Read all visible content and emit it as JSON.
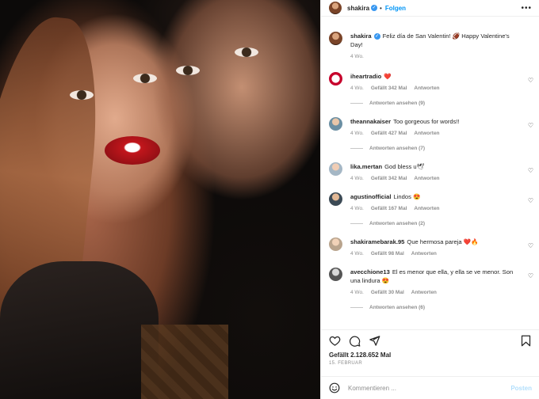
{
  "header": {
    "username": "shakira",
    "follow_label": "Folgen"
  },
  "caption": {
    "username": "shakira",
    "text": "Feliz día de San Valentin! 🏈 Happy Valentine's Day!",
    "time": "4 Wo."
  },
  "comments": [
    {
      "username": "iheartradio",
      "text": "❤️",
      "time": "4 Wo.",
      "likes": "Gefällt 342 Mal",
      "reply": "Antworten",
      "replies": "Antworten ansehen (9)"
    },
    {
      "username": "theannakaiser",
      "text": "Too gorgeous for words!!",
      "time": "4 Wo.",
      "likes": "Gefällt 427 Mal",
      "reply": "Antworten",
      "replies": "Antworten ansehen (7)"
    },
    {
      "username": "lika.mertan",
      "text": "God bless u🕊",
      "time": "4 Wo.",
      "likes": "Gefällt 342 Mal",
      "reply": "Antworten"
    },
    {
      "username": "agustinofficial",
      "text": "Lindos 😍",
      "time": "4 Wo.",
      "likes": "Gefällt 167 Mal",
      "reply": "Antworten",
      "replies": "Antworten ansehen (2)"
    },
    {
      "username": "shakiramebarak.95",
      "text": "Que hermosa pareja ❤️🔥",
      "time": "4 Wo.",
      "likes": "Gefällt 98 Mal",
      "reply": "Antworten"
    },
    {
      "username": "avecchione13",
      "text": "El es menor que ella, y ella se ve menor. Son una lindura 😍",
      "time": "4 Wo.",
      "likes": "Gefällt 30 Mal",
      "reply": "Antworten",
      "replies": "Antworten ansehen (6)"
    }
  ],
  "footer": {
    "likes": "Gefällt 2.128.652 Mal",
    "date": "15. FEBRUAR",
    "comment_placeholder": "Kommentieren ...",
    "post_label": "Posten"
  },
  "colors": {
    "accent": "#0095f6",
    "verified": "#3897f0",
    "heart_red": "#ed4956"
  }
}
